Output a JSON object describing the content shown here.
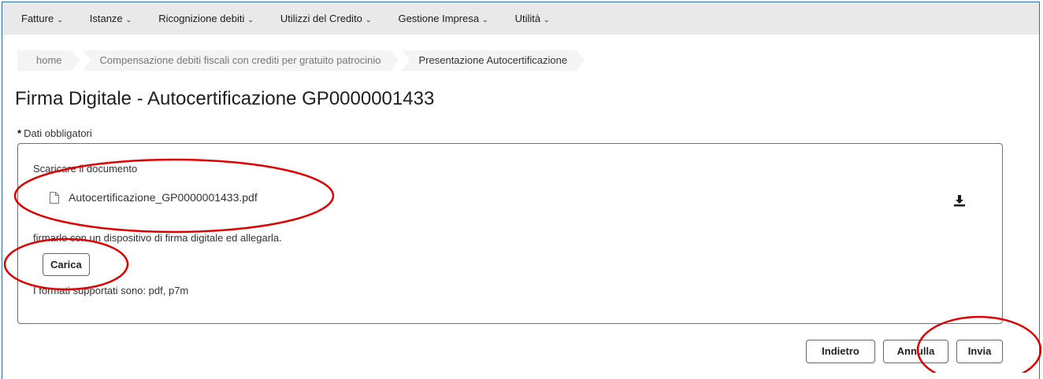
{
  "nav": {
    "items": [
      {
        "label": "Fatture"
      },
      {
        "label": "Istanze"
      },
      {
        "label": "Ricognizione debiti"
      },
      {
        "label": "Utilizzi del Credito"
      },
      {
        "label": "Gestione Impresa"
      },
      {
        "label": "Utilità"
      }
    ]
  },
  "breadcrumb": [
    {
      "label": "home"
    },
    {
      "label": "Compensazione debiti fiscali con crediti per gratuito patrocinio"
    },
    {
      "label": "Presentazione Autocertificazione"
    }
  ],
  "page": {
    "title": "Firma Digitale - Autocertificazione GP0000001433",
    "required_star": "*",
    "required_note": "Dati obbligatori"
  },
  "panel": {
    "download_instruction": "Scaricare il documento",
    "file_name": "Autocertificazione_GP0000001433.pdf",
    "sign_instruction": "firmarlo con un dispositivo di firma digitale ed allegarla.",
    "upload_label": "Carica",
    "formats_note": "I formati supportati sono: pdf, p7m"
  },
  "actions": {
    "back_label": "Indietro",
    "cancel_label": "Annulla",
    "send_label": "Invia"
  },
  "colors": {
    "frame": "#2f6fb3",
    "annotation": "#e00000",
    "nav_bg": "#e9e9e9"
  },
  "icons": [
    "chevron-down-icon",
    "file-icon",
    "download-icon"
  ]
}
